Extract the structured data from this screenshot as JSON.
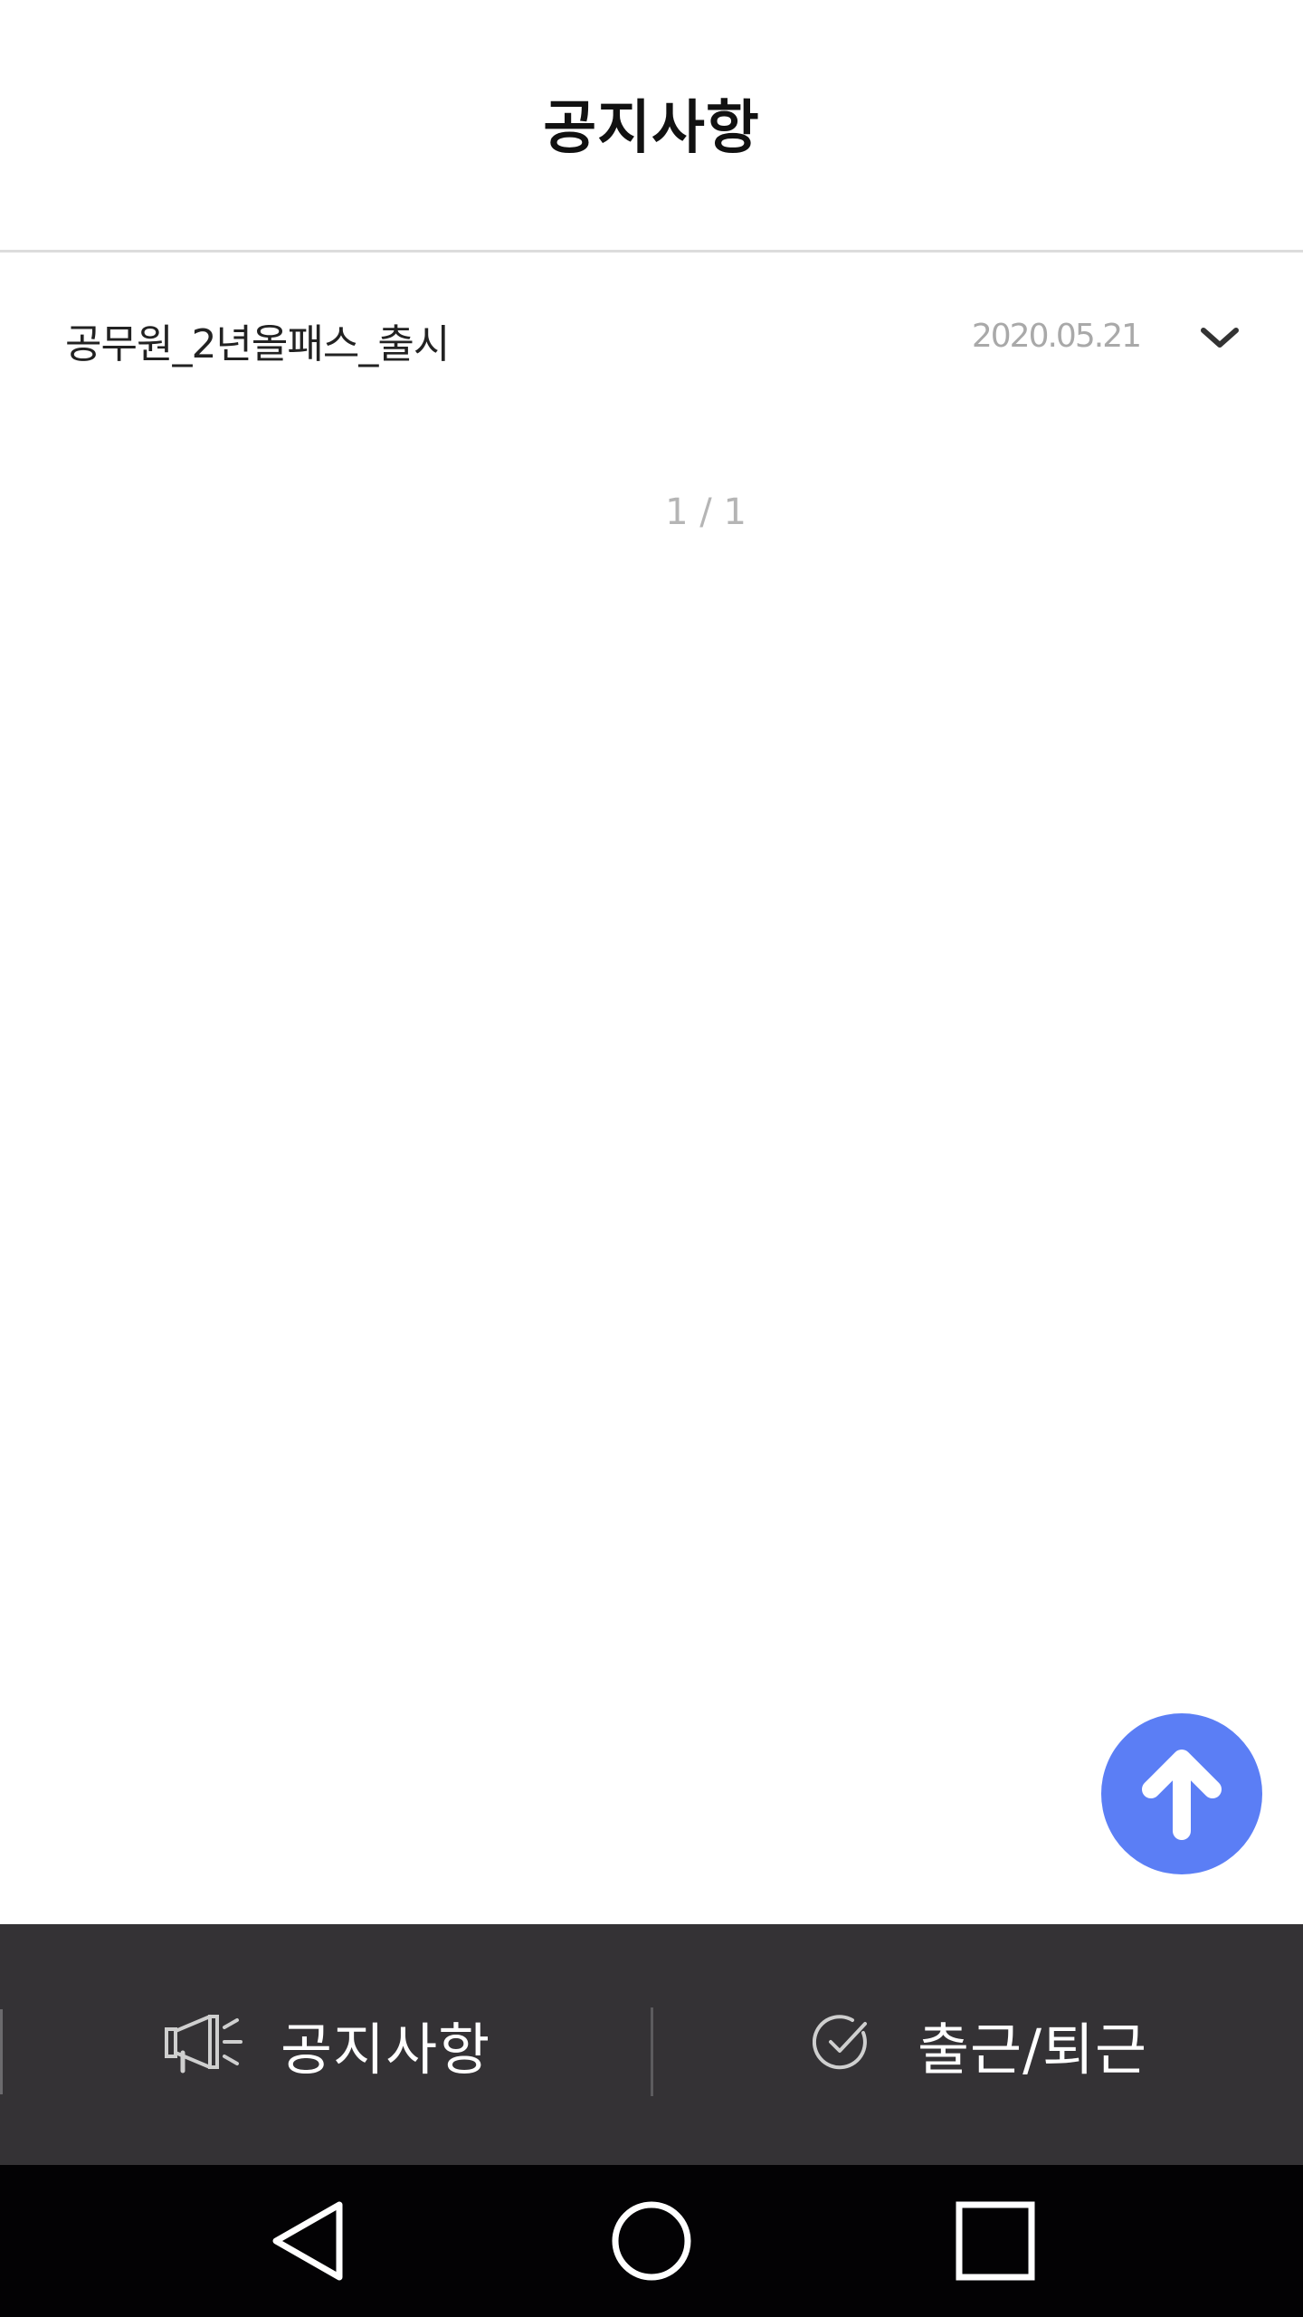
{
  "header": {
    "title": "공지사항"
  },
  "notices": [
    {
      "title": "공무원_2년올패스_출시",
      "date": "2020.05.21",
      "expand_icon": "chevron-down-icon"
    }
  ],
  "pagination": {
    "text": "1 / 1"
  },
  "scroll_top": {
    "icon": "arrow-up-icon",
    "color": "#5b7ef5"
  },
  "bottom_nav": {
    "items": [
      {
        "label": "공지사항",
        "icon": "megaphone-icon"
      },
      {
        "label": "출근/퇴근",
        "icon": "check-circle-icon"
      }
    ],
    "background": "#343235"
  },
  "system_nav": {
    "buttons": [
      "back-icon",
      "home-icon",
      "recents-icon"
    ]
  }
}
